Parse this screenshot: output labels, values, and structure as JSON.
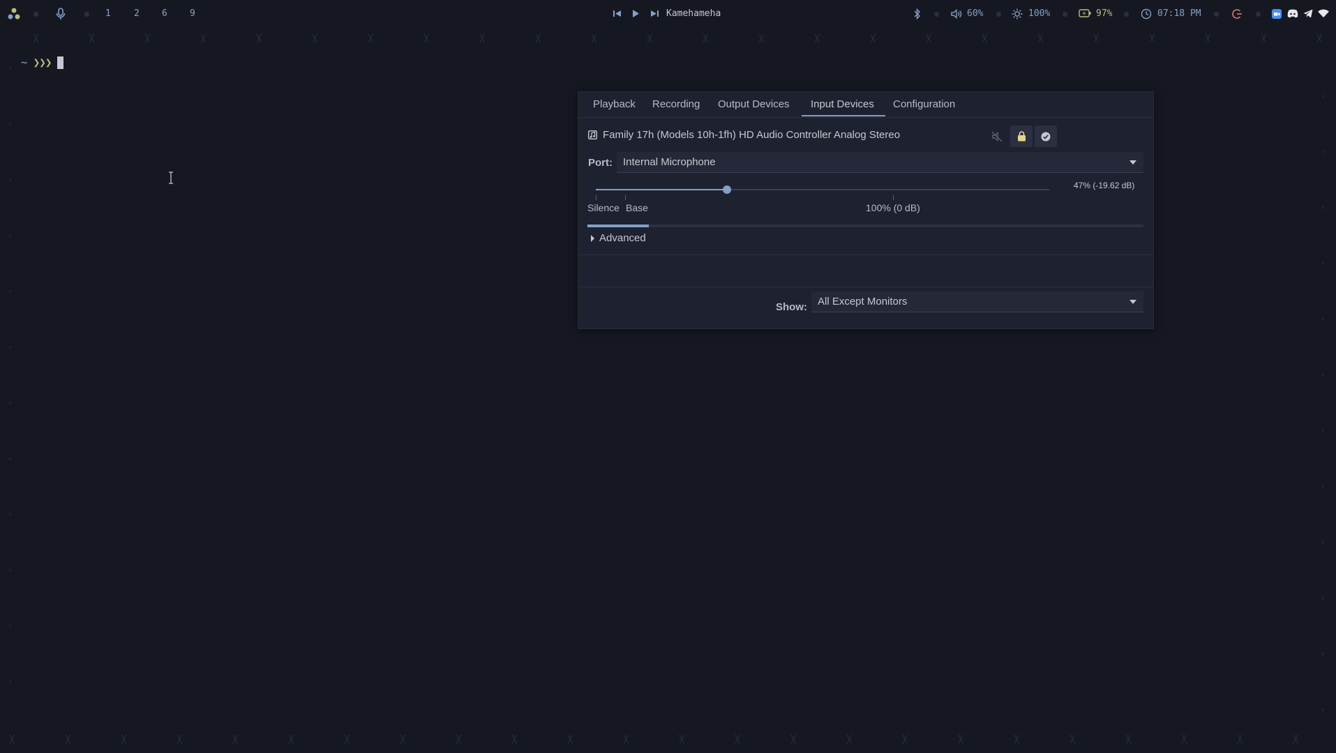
{
  "topbar": {
    "workspaces": [
      "1",
      "2",
      "6",
      "9"
    ],
    "media_title": "Kamehameha",
    "volume": "60%",
    "brightness": "100%",
    "battery": "97%",
    "time": "07:18 PM"
  },
  "terminal": {
    "prompt_dir": "~",
    "prompt_symbol": "»»"
  },
  "pavucontrol": {
    "tabs": [
      "Playback",
      "Recording",
      "Output Devices",
      "Input Devices",
      "Configuration"
    ],
    "active_tab": "Input Devices",
    "device_name": "Family 17h (Models 10h-1fh) HD Audio Controller Analog Stereo",
    "port_label": "Port:",
    "port_value": "Internal Microphone",
    "volume_percent": 47,
    "volume_text": "47% (-19.62 dB)",
    "scale_silence": "Silence",
    "scale_base": "Base",
    "scale_100": "100% (0 dB)",
    "peak_level": 0.11,
    "advanced_label": "Advanced",
    "show_label": "Show:",
    "show_value": "All Except Monitors"
  },
  "colors": {
    "background": "#161821",
    "accent": "#84a0c6",
    "green": "#b4be82",
    "red": "#e27878"
  }
}
